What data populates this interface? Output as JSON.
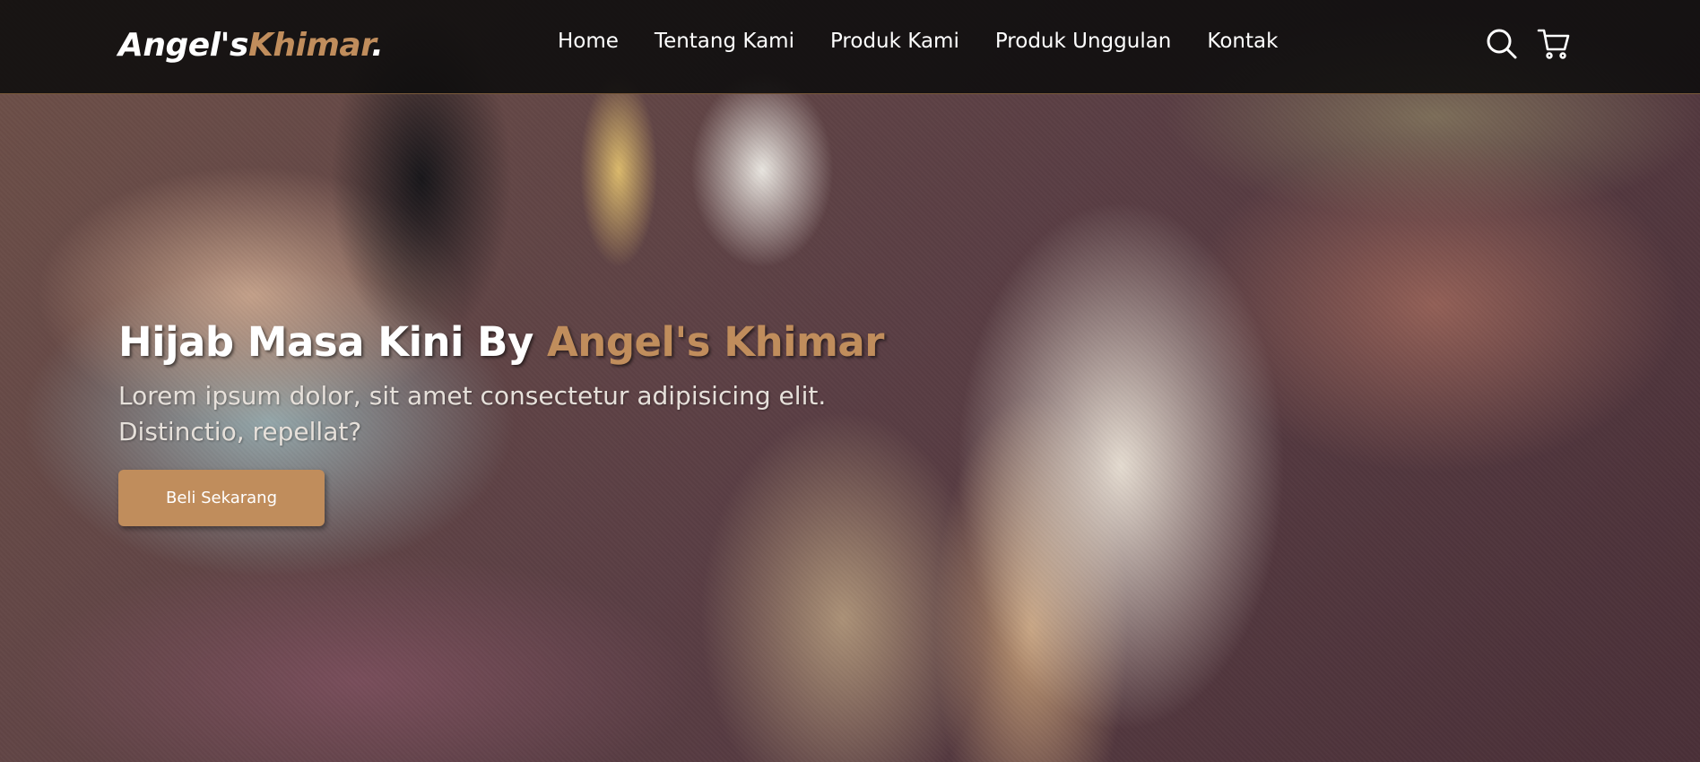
{
  "brand": {
    "name_part1": "Angel's",
    "name_part2": "Khimar",
    "name_suffix": ".",
    "accent_color": "#c08d5c"
  },
  "nav": {
    "links": [
      {
        "label": "Home"
      },
      {
        "label": "Tentang Kami"
      },
      {
        "label": "Produk Kami"
      },
      {
        "label": "Produk Unggulan"
      },
      {
        "label": "Kontak"
      }
    ],
    "icons": [
      "search-icon",
      "shopping-cart-icon"
    ]
  },
  "hero": {
    "title_prefix": "Hijab Masa Kini By ",
    "title_accent": "Angel's Khimar",
    "description": "Lorem ipsum dolor, sit amet consectetur adipisicing elit. Distinctio, repellat?",
    "cta_label": "Beli Sekarang"
  }
}
